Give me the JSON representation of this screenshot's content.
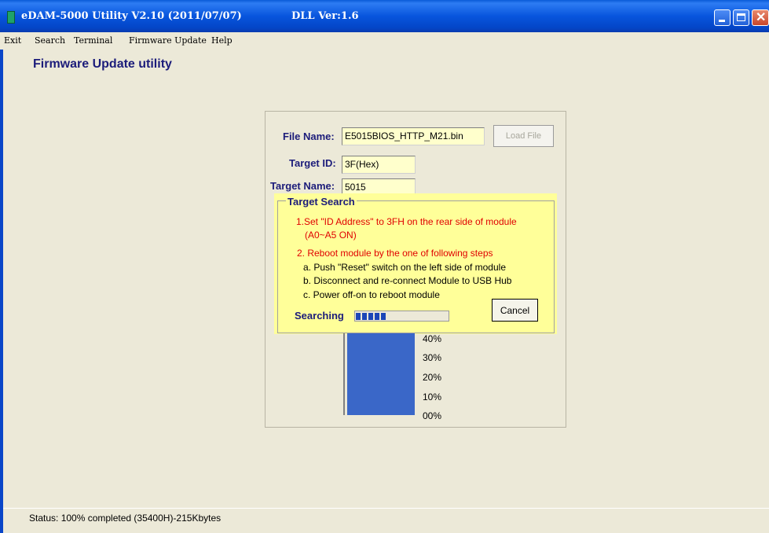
{
  "window": {
    "title": "eDAM-5000 Utility  V2.10 (2011/07/07)",
    "dll_version": "DLL Ver:1.6",
    "titlebar_color": "#0a5bd8"
  },
  "menu": [
    "Exit",
    "Search",
    "Terminal",
    "Firmware Update",
    "Help"
  ],
  "page_heading": "Firmware Update utility",
  "form": {
    "file_name_label": "File Name:",
    "file_name_value": "E5015BIOS_HTTP_M21.bin",
    "load_file_label": "Load File",
    "target_id_label": "Target ID:",
    "target_id_value": "3F(Hex)",
    "target_name_label": "Target Name:",
    "target_name_value": "5015"
  },
  "target_search": {
    "title": "Target Search",
    "line1": "1.Set \"ID Address\" to 3FH on the rear side of module",
    "line1b": "(A0~A5 ON)",
    "line2": "2. Reboot module by  the one of following steps",
    "step_a": "a. Push \"Reset\" switch on the left side of module",
    "step_b": "b. Disconnect and re-connect Module to USB Hub",
    "step_c": "c. Power off-on to reboot module",
    "cancel_label": "Cancel",
    "searching_label": "Searching",
    "searching_blocks": 5,
    "panel_color": "#ffff99"
  },
  "progress": {
    "labels": [
      "40%",
      "30%",
      "20%",
      "10%",
      "00%"
    ],
    "value_percent": 100,
    "bar_color": "#3a67c8"
  },
  "status": "Status: 100% completed (35400H)-215Kbytes"
}
